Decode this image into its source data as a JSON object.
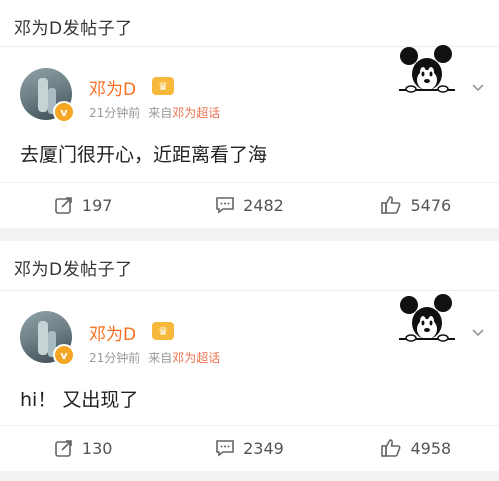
{
  "posts": [
    {
      "repost_title": "邓为D发帖子了",
      "username": "邓为D",
      "member_badge": "♛",
      "verified_badge": "v",
      "time": "21分钟前",
      "source_prefix": "来自",
      "source_link": "邓为超话",
      "content": "去厦门很开心，近距离看了海",
      "reposts": "197",
      "comments": "2482",
      "likes": "5476",
      "icons": {
        "repost": "share-icon",
        "comment": "comment-icon",
        "like": "thumbs-up-icon",
        "more": "chevron-down-icon",
        "decoration": "mickey-mouse-icon"
      }
    },
    {
      "repost_title": "邓为D发帖子了",
      "username": "邓为D",
      "member_badge": "♛",
      "verified_badge": "v",
      "time": "21分钟前",
      "source_prefix": "来自",
      "source_link": "邓为超话",
      "content": "hi！ 又出现了",
      "reposts": "130",
      "comments": "2349",
      "likes": "4958",
      "icons": {
        "repost": "share-icon",
        "comment": "comment-icon",
        "like": "thumbs-up-icon",
        "more": "chevron-down-icon",
        "decoration": "mickey-mouse-icon"
      }
    }
  ],
  "colors": {
    "username": "#f86e1f",
    "source_link": "#eb7350",
    "meta": "#999999",
    "background": "#f2f2f2"
  }
}
